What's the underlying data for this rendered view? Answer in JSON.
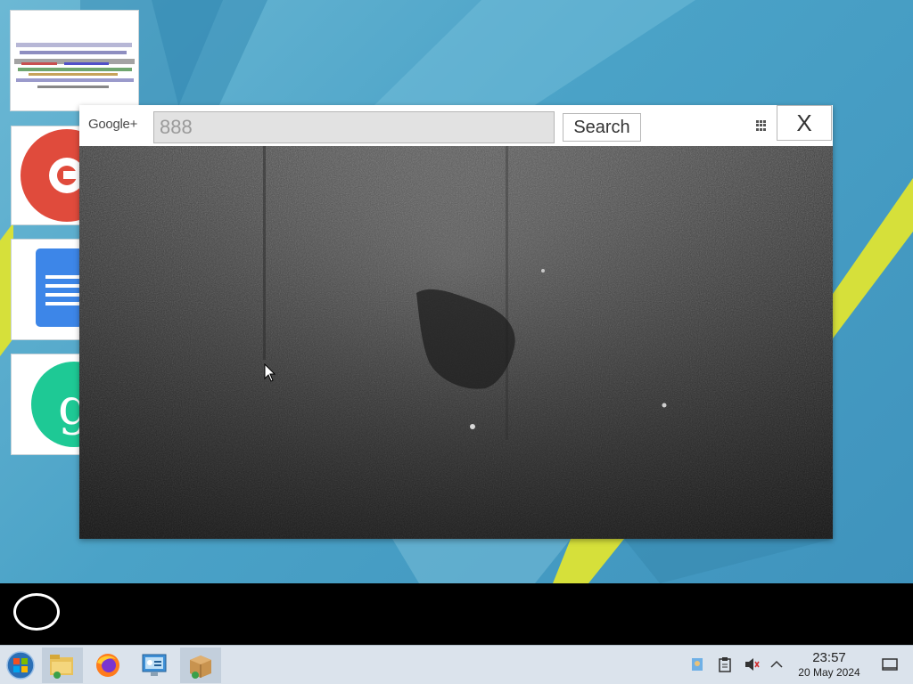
{
  "popup": {
    "brand": "Google+",
    "search_value": "888",
    "search_button": "Search",
    "close_label": "X"
  },
  "taskbar": {
    "time": "23:57",
    "date": "20 May 2024",
    "pinned": [
      "start-button",
      "file-manager",
      "firefox",
      "network-settings",
      "package-installer"
    ]
  },
  "colors": {
    "desktop_bg": "#4aa2c7",
    "taskbar_bg": "#dbe3ec",
    "black_bar": "#000000",
    "stripe_yellow": "#d6e03a"
  }
}
